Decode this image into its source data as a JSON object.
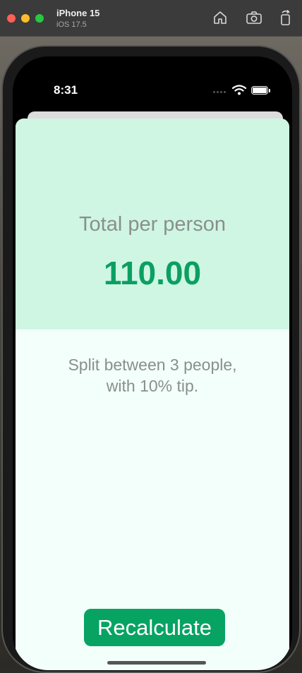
{
  "simulator": {
    "device_name": "iPhone 15",
    "os_version": "iOS 17.5",
    "icons": [
      "home-icon",
      "screenshot-camera-icon",
      "rotate-icon"
    ]
  },
  "status_bar": {
    "time": "8:31"
  },
  "app": {
    "total_label": "Total per person",
    "total_value": "110.00",
    "summary_line1": "Split between 3 people,",
    "summary_line2": "with 10% tip.",
    "recalculate_label": "Recalculate"
  },
  "colors": {
    "accent": "#07a363",
    "total_value": "#0b9f62",
    "header_bg": "#cff6e3",
    "sheet_bg": "#f3fffa",
    "muted_text": "#8a8f8c"
  }
}
